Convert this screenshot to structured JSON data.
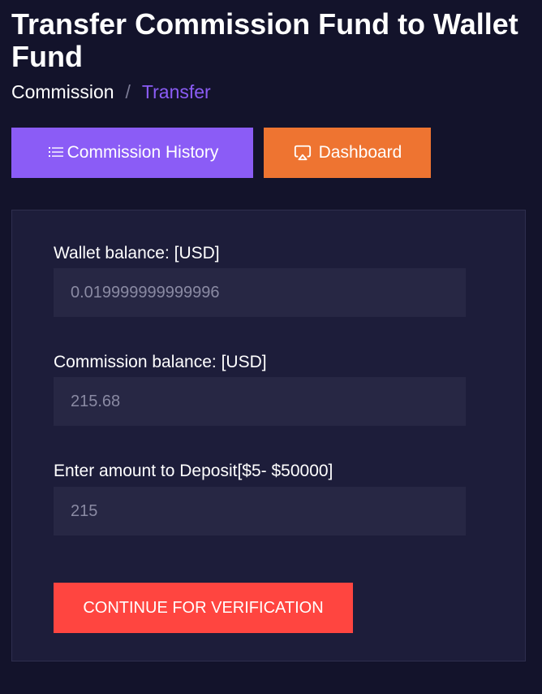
{
  "header": {
    "title": "Transfer Commission Fund to Wallet Fund"
  },
  "breadcrumb": {
    "home": "Commission",
    "separator": "/",
    "current": "Transfer"
  },
  "actions": {
    "history_label": "Commission History",
    "history_icon": "list-icon",
    "dashboard_label": "Dashboard",
    "dashboard_icon": "airplay-icon"
  },
  "form": {
    "wallet_label": "Wallet balance: [USD]",
    "wallet_value": "0.019999999999996",
    "commission_label": "Commission balance: [USD]",
    "commission_value": "215.68",
    "amount_label": "Enter amount to Deposit[$5- $50000]",
    "amount_value": "215",
    "submit_label": "CONTINUE FOR VERIFICATION"
  },
  "colors": {
    "background": "#13132b",
    "card": "#1d1d3a",
    "purple": "#8b5cf6",
    "orange": "#ee7431",
    "red": "#ff4540"
  }
}
